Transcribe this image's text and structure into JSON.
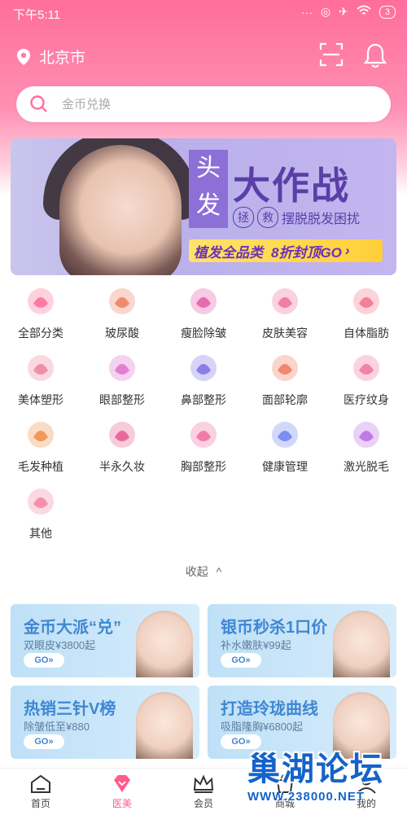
{
  "status_bar": {
    "time": "下午5:11",
    "battery": "3"
  },
  "header": {
    "location": "北京市"
  },
  "search": {
    "placeholder": "金币兑换"
  },
  "banner": {
    "box_text_1": "头",
    "box_text_2": "发",
    "title": "大作战",
    "circle_1": "拯",
    "circle_2": "救",
    "subtitle": "摆脱脱发困扰",
    "bar_left": "植发全品类",
    "bar_right": "8折封顶GO",
    "bar_arrow": "›"
  },
  "categories": [
    {
      "label": "全部分类",
      "icon": "all-category-icon",
      "color": "#ff7aa2"
    },
    {
      "label": "玻尿酸",
      "icon": "hyaluronic-icon",
      "color": "#f08a6e"
    },
    {
      "label": "瘦脸除皱",
      "icon": "face-slim-icon",
      "color": "#e86ab0"
    },
    {
      "label": "皮肤美容",
      "icon": "skin-icon",
      "color": "#f27ea4"
    },
    {
      "label": "自体脂肪",
      "icon": "fat-icon",
      "color": "#f57e98"
    },
    {
      "label": "美体塑形",
      "icon": "body-icon",
      "color": "#f08fa8"
    },
    {
      "label": "眼部整形",
      "icon": "eye-icon",
      "color": "#e37fd0"
    },
    {
      "label": "鼻部整形",
      "icon": "nose-icon",
      "color": "#8b7de8"
    },
    {
      "label": "面部轮廓",
      "icon": "face-contour-icon",
      "color": "#f0886e"
    },
    {
      "label": "医疗纹身",
      "icon": "tattoo-icon",
      "color": "#f482a6"
    },
    {
      "label": "毛发种植",
      "icon": "hair-icon",
      "color": "#f09a5a"
    },
    {
      "label": "半永久妆",
      "icon": "brow-icon",
      "color": "#e76a9c"
    },
    {
      "label": "胸部整形",
      "icon": "chest-icon",
      "color": "#f27aa8"
    },
    {
      "label": "健康管理",
      "icon": "heart-icon",
      "color": "#7d8ef0"
    },
    {
      "label": "激光脱毛",
      "icon": "laser-icon",
      "color": "#c07ae8"
    },
    {
      "label": "其他",
      "icon": "other-icon",
      "color": "#f590ac"
    }
  ],
  "collapse": {
    "label": "收起",
    "arrow": "^"
  },
  "promos": [
    {
      "title": "金币大派“兑”",
      "sub": "双眼皮¥3800起",
      "go": "GO»"
    },
    {
      "title": "银币秒杀1口价",
      "sub": "补水嫩肤¥99起",
      "go": "GO»"
    },
    {
      "title": "热销三针V榜",
      "sub": "除皱低至¥880",
      "go": "GO»"
    },
    {
      "title": "打造玲珑曲线",
      "sub": "吸脂隆胸¥6800起",
      "go": "GO»"
    }
  ],
  "bottom_nav": [
    {
      "label": "首页",
      "icon": "home-icon"
    },
    {
      "label": "医美",
      "icon": "diamond-icon",
      "active": true
    },
    {
      "label": "会员",
      "icon": "crown-icon"
    },
    {
      "label": "商城",
      "icon": "shop-icon"
    },
    {
      "label": "我的",
      "icon": "user-icon"
    }
  ],
  "watermark": {
    "big": "巢湖论坛",
    "small": "WWW.238000.NET"
  }
}
